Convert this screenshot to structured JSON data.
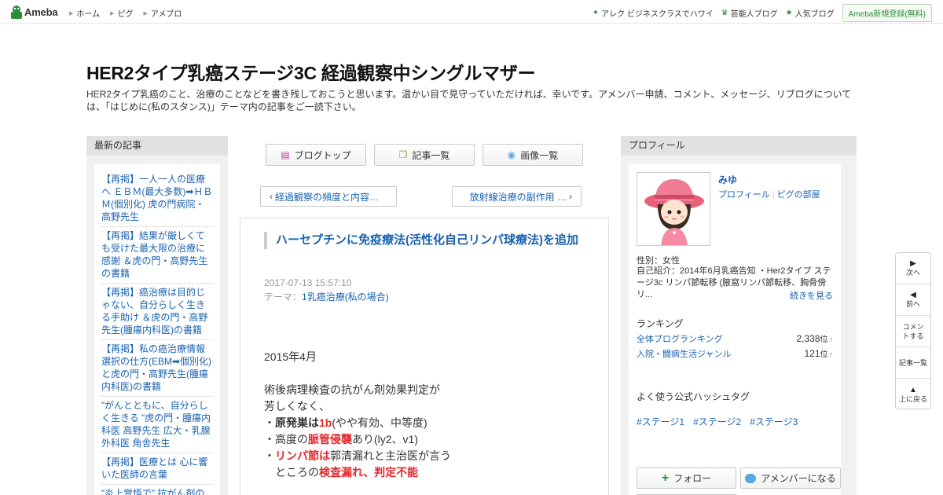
{
  "topbar": {
    "logo_text": "Ameba",
    "nav": [
      "ホーム",
      "ピグ",
      "アメブロ"
    ],
    "right_links": [
      {
        "label": "アレク ビジネスクラスでハワイ",
        "icon": "sparkle-icon"
      },
      {
        "label": "芸能人ブログ",
        "icon": "crown-icon"
      },
      {
        "label": "人気ブログ",
        "icon": "star-icon"
      }
    ],
    "register_label": "Ameba新規登録(無料)"
  },
  "blog": {
    "title": "HER2タイプ乳癌ステージ3C 経過観察中シングルマザー",
    "description": "HER2タイプ乳癌のこと、治療のことなどを書き残しておこうと思います。温かい目で見守っていただければ、幸いです。アメンバー申請、コメント、メッセージ、リブログについては、「はじめに(私のスタンス)」テーマ内の記事をご一読下さい。"
  },
  "left": {
    "heading": "最新の記事",
    "recent": [
      "【再掲】一人一人の医療へ ＥＢＭ(最大多数)➡ＨＢＭ(個別化) 虎の門病院・高野先生",
      "【再掲】結果が厳しくても受けた最大限の治療に感謝 ＆虎の門・高野先生の書籍",
      "【再掲】癌治療は目的じゃない、自分らしく生きる手助け ＆虎の門・高野先生(腫瘍内科医)の書籍",
      "【再掲】私の癌治療情報選択の仕方(EBM➡個別化)と虎の門・高野先生(腫瘍内科医)の書籍",
      "”がんとともに、自分らしく生きる ”虎の門・腫瘍内科医 高野先生 広大・乳腺外科医 角舎先生",
      "【再掲】医療とは 心に響いた医師の言葉",
      "”炎上覚悟で” 抗がん剤の"
    ]
  },
  "center": {
    "buttons": [
      "ブログトップ",
      "記事一覧",
      "画像一覧"
    ],
    "prev_label": "経過観察の頻度と内容…",
    "next_label": "放射線治療の副作用 …",
    "entry": {
      "title": "ハーセプチンに免疫療法(活性化自己リンパ球療法)を追加",
      "date": "2017-07-13 15:57:10",
      "theme_prefix": "テーマ：",
      "theme": "1乳癌治療(私の場合)",
      "p1": "2015年4月",
      "p2a": "術後病理検査の抗がん剤効果判定が",
      "p2b": "芳しくなく、",
      "b1_pre": "・",
      "b1_bold": "原発巣は",
      "b1_red": "1b",
      "b1_post": "(やや有効、中等度)",
      "b2_pre": "・高度の",
      "b2_red": "脈管侵襲",
      "b2_post": "あり(ly2、v1)",
      "b3_pre": "・",
      "b3_red": "リンパ節は",
      "b3_post": "郭清漏れと主治医が言う",
      "b4_pre": "　ところの",
      "b4_red": "検査漏れ、判定不能"
    }
  },
  "right": {
    "heading": "プロフィール",
    "name": "みゆ",
    "link_profile": "プロフィール",
    "link_room": "ピグの部屋",
    "attr": "性別：女性",
    "intro": "自己紹介：2014年6月乳癌告知 ・Her2タイプ ステージ3c リンパ節転移 (腋窩リンパ節転移、胸骨傍リ...",
    "readmore": "続きを見る",
    "ranking_heading": "ランキング",
    "rankings": [
      {
        "label": "全体ブログランキング",
        "value": "2,338",
        "unit": "位",
        "trend": "↑"
      },
      {
        "label": "入院・闘病生活ジャンル",
        "value": "121",
        "unit": "位",
        "trend": "↑"
      }
    ],
    "hashtag_heading": "よく使う公式ハッシュタグ",
    "hashtags": [
      "#ステージ1",
      "#ステージ2",
      "#ステージ3"
    ],
    "follow_label": "フォロー",
    "amember_label": "アメンバーになる"
  },
  "side_nav": [
    "次へ",
    "前へ",
    "コメントする",
    "記事一覧",
    "上に戻る"
  ],
  "colors": {
    "link": "#1a62b0",
    "accent_red": "#e5282d",
    "brand_green": "#2d8c3c"
  }
}
